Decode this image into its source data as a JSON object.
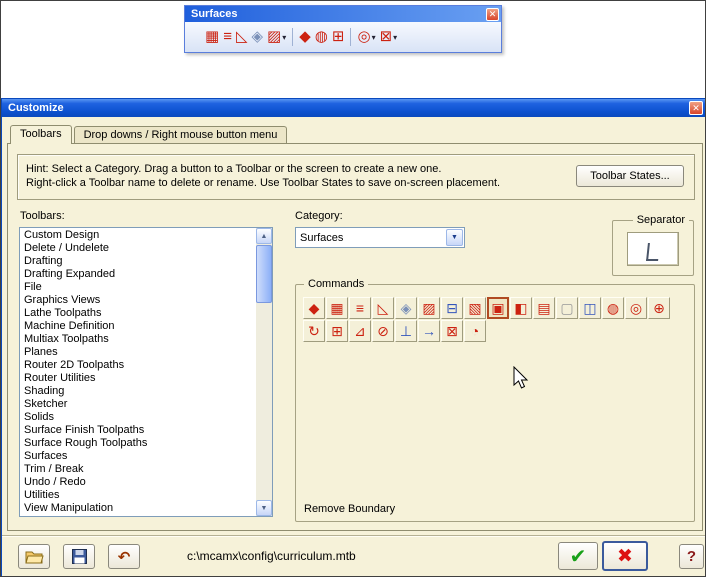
{
  "surfaces_toolbar": {
    "title": "Surfaces",
    "close_glyph": "✕",
    "icons": [
      {
        "name": "surface-grid-icon",
        "glyph": "▦",
        "color": "#cc2211"
      },
      {
        "name": "flat-boundary-surface-icon",
        "glyph": "≡",
        "color": "#cc2211"
      },
      {
        "name": "ruled-surface-icon",
        "glyph": "◺",
        "color": "#cc2211"
      },
      {
        "name": "blend-surface-icon",
        "glyph": "◈",
        "color": "#7a90b8"
      },
      {
        "name": "fillet-surface-icon",
        "glyph": "▨",
        "color": "#cc2211",
        "dd": "▾"
      },
      {
        "sep": true
      },
      {
        "name": "offset-surface-icon",
        "glyph": "◆",
        "color": "#cc2211"
      },
      {
        "name": "swept-surface-icon",
        "glyph": "◍",
        "color": "#cc2211"
      },
      {
        "name": "net-surface-icon",
        "glyph": "⊞",
        "color": "#cc2211"
      },
      {
        "sep": true
      },
      {
        "name": "primitive-surface-icon",
        "glyph": "◎",
        "color": "#cc2211",
        "dd": "▾"
      },
      {
        "name": "trim-surface-icon",
        "glyph": "⊠",
        "color": "#cc2211",
        "dd": "▾"
      }
    ]
  },
  "dialog": {
    "title": "Customize",
    "close_glyph": "✕",
    "tabs": [
      {
        "label": "Toolbars"
      },
      {
        "label": "Drop downs / Right mouse button menu"
      }
    ],
    "hint": {
      "line1": "Hint:  Select a Category.  Drag a button to a Toolbar or the screen to create a new one.",
      "line2": "Right-click a Toolbar name to delete or rename.  Use Toolbar States to save on-screen placement."
    },
    "toolbar_states_button": "Toolbar States...",
    "toolbars": {
      "label": "Toolbars:",
      "items": [
        "Custom Design",
        "Delete / Undelete",
        "Drafting",
        "Drafting Expanded",
        "File",
        "Graphics Views",
        "Lathe Toolpaths",
        "Machine Definition",
        "Multiax Toolpaths",
        "Planes",
        "Router 2D Toolpaths",
        "Router Utilities",
        "Shading",
        "Sketcher",
        "Solids",
        "Surface Finish Toolpaths",
        "Surface Rough Toolpaths",
        "Surfaces",
        "Trim / Break",
        "Undo / Redo",
        "Utilities",
        "View Manipulation"
      ],
      "scrollbar": {
        "up": "▲",
        "down": "▼"
      }
    },
    "category": {
      "label": "Category:",
      "value": "Surfaces",
      "arrow": "▼"
    },
    "separator": {
      "label": "Separator"
    },
    "commands": {
      "label": "Commands",
      "status": "Remove Boundary",
      "icons": [
        {
          "name": "swept-surface-cmd-icon",
          "glyph": "◆",
          "color": "#cc2211"
        },
        {
          "name": "draft-surface-cmd-icon",
          "glyph": "▦",
          "color": "#cc2211"
        },
        {
          "name": "flat-boundary-cmd-icon",
          "glyph": "≡",
          "color": "#cc2211"
        },
        {
          "name": "ruled-surface-cmd-icon",
          "glyph": "◺",
          "color": "#cc2211"
        },
        {
          "name": "blend-surface-cmd-icon",
          "glyph": "◈",
          "color": "#7a90b8"
        },
        {
          "name": "fillet-surface-cmd-icon",
          "glyph": "▨",
          "color": "#cc2211"
        },
        {
          "name": "extend-surface-cmd-icon",
          "glyph": "⊟",
          "color": "#3355bb"
        },
        {
          "name": "offset-surface-cmd-icon",
          "glyph": "▧",
          "color": "#cc2211"
        },
        {
          "name": "remove-boundary-cmd-icon",
          "glyph": "▣",
          "color": "#cc2211",
          "selected": true
        },
        {
          "name": "split-surface-cmd-icon",
          "glyph": "◧",
          "color": "#cc2211"
        },
        {
          "name": "untrim-surface-cmd-icon",
          "glyph": "▤",
          "color": "#cc2211"
        },
        {
          "name": "unsplit-surface-cmd-icon",
          "glyph": "▢",
          "color": "#999999"
        },
        {
          "name": "box-primitive-cmd-icon",
          "glyph": "◫",
          "color": "#3355bb"
        },
        {
          "name": "sphere-primitive-cmd-icon",
          "glyph": "◍",
          "color": "#cc2211"
        },
        {
          "name": "cylinder-primitive-cmd-icon",
          "glyph": "◎",
          "color": "#cc2211"
        },
        {
          "name": "cone-primitive-cmd-icon",
          "glyph": "⊕",
          "color": "#cc2211"
        },
        {
          "name": "revolved-surface-cmd-icon",
          "glyph": "↻",
          "color": "#cc2211"
        },
        {
          "name": "net-surface-cmd-icon",
          "glyph": "⊞",
          "color": "#cc2211"
        },
        {
          "name": "loft-surface-cmd-icon",
          "glyph": "⊿",
          "color": "#cc2211"
        },
        {
          "name": "delete-surface-cmd-icon",
          "glyph": "⊘",
          "color": "#cc2211"
        },
        {
          "name": "extrude-surface-cmd-icon",
          "glyph": "⊥",
          "color": "#3355bb"
        },
        {
          "name": "push-surface-cmd-icon",
          "glyph": "→",
          "color": "#3355bb"
        },
        {
          "name": "trim-surface-cmd-icon",
          "glyph": "⊠",
          "color": "#cc2211"
        },
        {
          "name": "fillet-plane-cmd-icon",
          "glyph": "◔",
          "color": "#cc2211"
        }
      ]
    },
    "footer": {
      "path": "c:\\mcamx\\config\\curriculum.mtb",
      "undo_glyph": "↶",
      "ok_glyph": "✔",
      "cancel_glyph": "✖",
      "help_glyph": "?"
    }
  }
}
